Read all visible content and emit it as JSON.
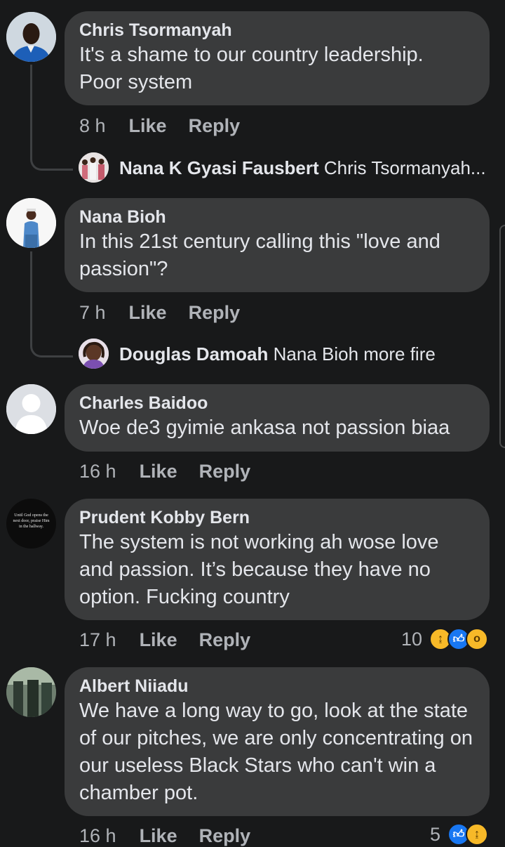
{
  "comments": [
    {
      "author": "Chris Tsormanyah",
      "text": "It's a shame to our country leadership. Poor system",
      "time": "8 h",
      "like": "Like",
      "reply": "Reply",
      "reply_preview": {
        "author": "Nana K Gyasi Fausbert",
        "text": "Chris Tsormanyah..."
      }
    },
    {
      "author": "Nana Bioh",
      "text": "In this 21st century calling this \"love and passion\"?",
      "time": "7 h",
      "like": "Like",
      "reply": "Reply",
      "reply_preview": {
        "author": "Douglas Damoah",
        "text": "Nana Bioh more fire"
      }
    },
    {
      "author": "Charles Baidoo",
      "text": "Woe de3 gyimie ankasa not passion biaa",
      "time": "16 h",
      "like": "Like",
      "reply": "Reply"
    },
    {
      "author": "Prudent Kobby Bern",
      "text": "The system is not working ah wose love and passion. It’s because they have no option. Fucking country",
      "time": "17 h",
      "like": "Like",
      "reply": "Reply",
      "reaction_count": "10",
      "reactions": [
        "haha-icon",
        "like-icon",
        "wow-icon"
      ],
      "avatar_text": "Until God opens the next door, praise Him in the hallway."
    },
    {
      "author": "Albert Niiadu",
      "text": "We have a long way to go, look at the state of our pitches, we are only concentrating on our useless Black Stars who can't win a chamber pot.",
      "time": "16 h",
      "like": "Like",
      "reply": "Reply",
      "reaction_count": "5",
      "reactions": [
        "like-icon",
        "haha-icon"
      ]
    }
  ],
  "colors": {
    "background": "#18191a",
    "bubble": "#3a3b3c",
    "text": "#e4e6eb",
    "secondary": "#b0b3b8",
    "like_blue": "#1877f2",
    "haha_yellow": "#f7b928"
  }
}
